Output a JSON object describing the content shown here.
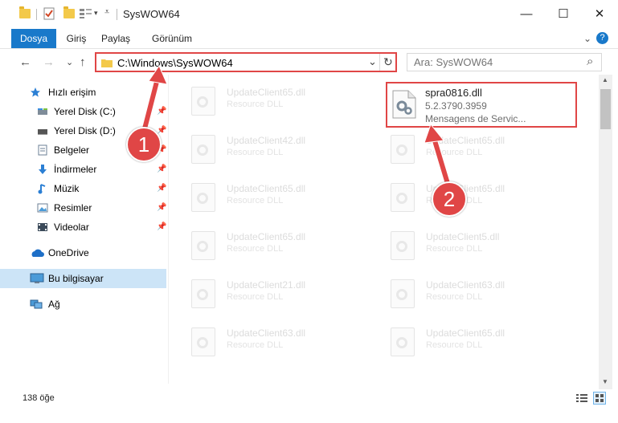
{
  "window": {
    "title": "SysWOW64",
    "minimize": "—",
    "maximize": "☐",
    "close": "✕"
  },
  "ribbon": {
    "tabs": [
      "Dosya",
      "Giriş",
      "Paylaş",
      "Görünüm"
    ],
    "expand": "⌄",
    "help": "?"
  },
  "address": {
    "path": "C:\\Windows\\SysWOW64",
    "dropdown": "⌄",
    "refresh": "↻"
  },
  "search": {
    "placeholder": "Ara: SysWOW64",
    "icon": "⌕"
  },
  "nav": {
    "back": "←",
    "forward": "→",
    "recent": "⌄",
    "up": "↑",
    "items": [
      {
        "label": "Hızlı erişim",
        "icon": "star-icon"
      },
      {
        "label": "Yerel Disk (C:)",
        "icon": "drive-icon",
        "pinned": true
      },
      {
        "label": "Yerel Disk (D:)",
        "icon": "drive-icon",
        "pinned": true
      },
      {
        "label": "Belgeler",
        "icon": "documents-icon",
        "pinned": true
      },
      {
        "label": "İndirmeler",
        "icon": "download-icon",
        "pinned": true
      },
      {
        "label": "Müzik",
        "icon": "music-icon",
        "pinned": true
      },
      {
        "label": "Resimler",
        "icon": "pictures-icon",
        "pinned": true
      },
      {
        "label": "Videolar",
        "icon": "videos-icon",
        "pinned": true
      },
      {
        "label": "OneDrive",
        "icon": "cloud-icon"
      },
      {
        "label": "Bu bilgisayar",
        "icon": "computer-icon",
        "selected": true
      },
      {
        "label": "Ağ",
        "icon": "network-icon"
      }
    ]
  },
  "files": {
    "left": [
      {
        "name": "UpdateClient65.dll",
        "desc": "Resource DLL"
      },
      {
        "name": "UpdateClient42.dll",
        "desc": "Resource DLL"
      },
      {
        "name": "UpdateClient65.dll",
        "desc": "Resource DLL"
      },
      {
        "name": "UpdateClient65.dll",
        "desc": "Resource DLL"
      },
      {
        "name": "UpdateClient21.dll",
        "desc": "Resource DLL"
      },
      {
        "name": "UpdateClient63.dll",
        "desc": "Resource DLL"
      }
    ],
    "right": [
      {
        "name": "UpdateClient65.dll",
        "desc": "Resource DLL"
      },
      {
        "name": "UpdateClient65.dll",
        "desc": "Resource DLL"
      },
      {
        "name": "UpdateClient5.dll",
        "desc": "Resource DLL"
      },
      {
        "name": "UpdateClient63.dll",
        "desc": "Resource DLL"
      },
      {
        "name": "UpdateClient65.dll",
        "desc": "Resource DLL"
      }
    ],
    "selected": {
      "name": "spra0816.dll",
      "version": "5.2.3790.3959",
      "desc": "Mensagens de Servic..."
    }
  },
  "status": {
    "count": "138 öğe"
  },
  "annotations": {
    "badge1": "1",
    "badge2": "2",
    "color": "#e04646"
  }
}
